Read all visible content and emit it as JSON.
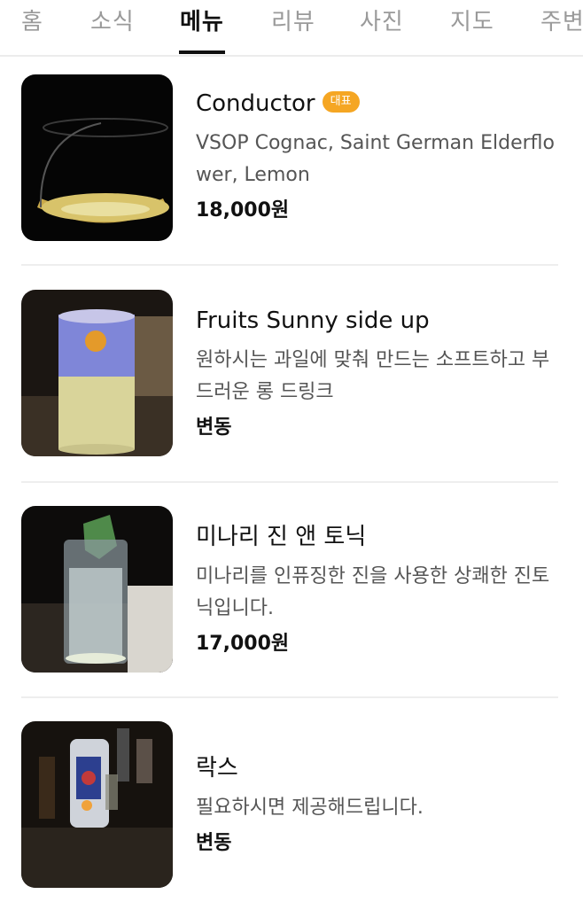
{
  "tabs": [
    "홈",
    "소식",
    "메뉴",
    "리뷰",
    "사진",
    "지도",
    "주변"
  ],
  "active_tab": "메뉴",
  "menu": [
    {
      "name": "Conductor",
      "badge": "대표",
      "desc": "VSOP Cognac, Saint German Elderflower, Lemon",
      "price": "18,000원"
    },
    {
      "name": "Fruits Sunny side up",
      "desc": "원하시는 과일에 맞춰 만드는 소프트하고 부드러운 롱 드링크",
      "price": "변동"
    },
    {
      "name": "미나리 진 앤 토닉",
      "desc": "미나리를 인퓨징한 진을 사용한 상쾌한 진토닉입니다.",
      "price": "17,000원"
    },
    {
      "name": "락스",
      "desc": "필요하시면 제공해드립니다.",
      "price": "변동"
    }
  ],
  "colors": {
    "accent": "#111111",
    "badge": "#f5a623",
    "divider": "#eeeeee"
  }
}
